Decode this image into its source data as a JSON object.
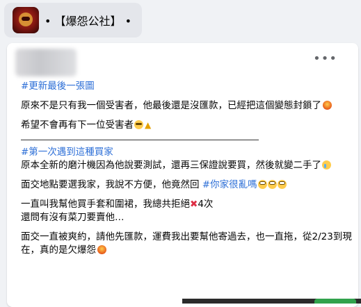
{
  "group": {
    "name": "• 【爆怨公社】 •"
  },
  "post": {
    "more_label": "•••",
    "update_tag": "#更新最後一張圖",
    "update_text_1": "原來不是只有我一個受害者，他最後還是沒匯款，已經把這個變態封鎖了",
    "update_text_2": "希望不會再有下一位受害者",
    "first_tag": "#第一次遇到這種買家",
    "para1": "原本全新的磨汁機因為他說要測試，還再三保證說要買，然後就變二手了",
    "para2_prefix": "面交地點要選我家，我說不方便，他竟然回 ",
    "para2_tag": "#你家很亂嗎",
    "para3_line1_prefix": "一直叫我幫他買手套和圍裙，我總共拒絕",
    "para3_line1_suffix": "4次",
    "para3_line2": "還問有沒有菜刀要賣他…",
    "para4": "面交一直被爽約，請他先匯款，運費我出要幫他寄過去，也一直拖，從2/23到現在，真的是欠爆怨"
  },
  "icons": {
    "avatar": "group-avatar",
    "more": "more-options-icon",
    "fire": "angry-emoji",
    "plead": "pleading-emoji",
    "pray": "folded-hands-emoji",
    "cry": "crying-emoji",
    "roll": "eye-roll-emoji",
    "cross": "cross-mark-emoji"
  },
  "colors": {
    "hashtag": "#2d6fd7",
    "background": "#f0f2f5",
    "card": "#ffffff"
  }
}
